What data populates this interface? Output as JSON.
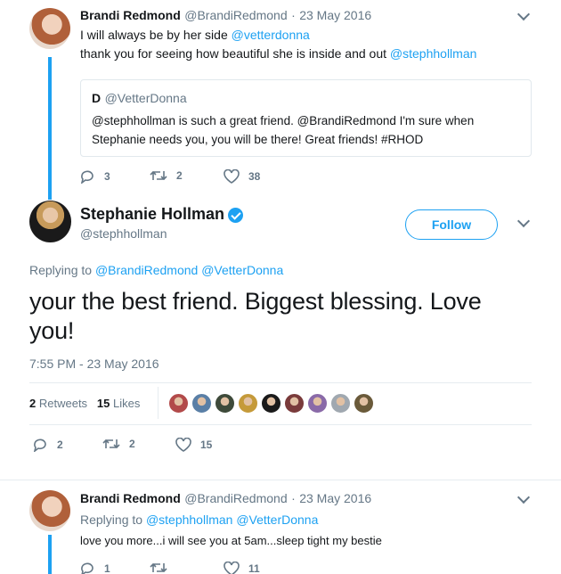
{
  "tweet1": {
    "name": "Brandi Redmond",
    "handle": "@BrandiRedmond",
    "sep": "·",
    "date": "23 May 2016",
    "line1_text": "I will always be by her side",
    "line1_mention": "@vetterdonna",
    "line2_text": "thank you for seeing how beautiful she is inside and out",
    "line2_mention": "@stephhollman",
    "quote": {
      "name": "D",
      "handle": "@VetterDonna",
      "text_line1": "@stephhollman is such a great friend. @BrandiRedmond I'm sure when",
      "text_line2": "Stephanie needs you, you will be there! Great friends! #RHOD"
    },
    "replies": "3",
    "retweets": "2",
    "likes": "38"
  },
  "main": {
    "name": "Stephanie Hollman",
    "handle": "@stephhollman",
    "follow_label": "Follow",
    "replying_prefix": "Replying to",
    "replying_to": "@BrandiRedmond @VetterDonna",
    "text_line1": "your the best friend.  Biggest blessing.  Love",
    "text_line2": "you!",
    "timestamp": "7:55 PM - 23 May 2016",
    "retweets_count": "2",
    "retweets_label": "Retweets",
    "likes_count": "15",
    "likes_label": "Likes",
    "replies": "2",
    "retweet_action": "2",
    "like_action": "15"
  },
  "tweet3": {
    "name": "Brandi Redmond",
    "handle": "@BrandiRedmond",
    "sep": "·",
    "date": "23 May 2016",
    "replying_prefix": "Replying to",
    "replying_to": "@stephhollman @VetterDonna",
    "text": "love you more...i will see you at 5am...sleep tight my bestie",
    "replies": "1",
    "likes": "11"
  },
  "colors": {
    "accent": "#1da1f2",
    "text": "#14171a",
    "muted": "#657786",
    "liker_colors": [
      "#b24a4a",
      "#5a7fa6",
      "#3e4a3a",
      "#c59a3a",
      "#1a1a1a",
      "#7a3b3b",
      "#8a6aa8",
      "#a0a8b0",
      "#6a5a3a"
    ]
  }
}
